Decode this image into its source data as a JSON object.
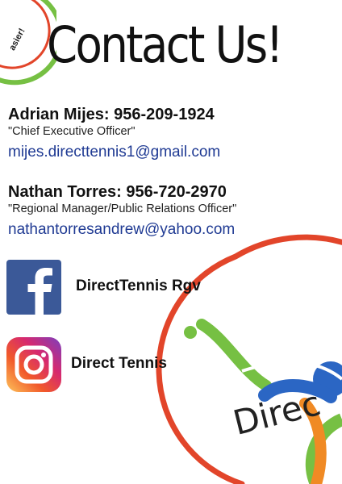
{
  "title": "Contact Us!",
  "logo_fragment": "asier!",
  "contacts": [
    {
      "name_phone": "Adrian Mijes: 956-209-1924",
      "role": "\"Chief Executive Officer\"",
      "email": "mijes.directtennis1@gmail.com"
    },
    {
      "name_phone": "Nathan Torres: 956-720-2970",
      "role": "\"Regional Manager/Public Relations Officer\"",
      "email": "nathantorresandrew@yahoo.com"
    }
  ],
  "social": [
    {
      "icon": "facebook-icon",
      "label": "DirectTennis Rgv"
    },
    {
      "icon": "instagram-icon",
      "label": "Direct Tennis"
    }
  ],
  "brand_fragment": "Direc",
  "colors": {
    "facebook_blue": "#3b5998",
    "email_blue": "#1f3a93",
    "brand_red": "#e2452a",
    "brand_green": "#76c043",
    "brand_blue": "#2b66c4"
  }
}
